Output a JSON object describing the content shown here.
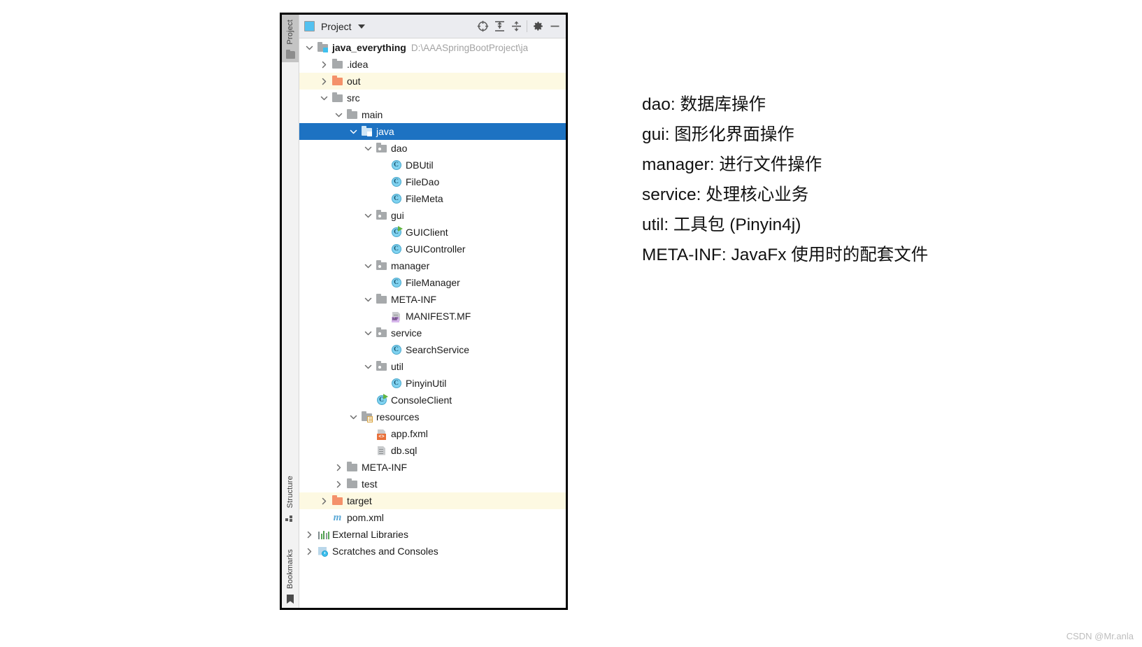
{
  "tool_strip": {
    "tabs_top": [
      {
        "label": "Project",
        "icon": "project-folder-icon"
      }
    ],
    "tabs_middle": [
      {
        "label": "Structure",
        "icon": "structure-icon"
      }
    ],
    "tabs_bottom": [
      {
        "label": "Bookmarks",
        "icon": "bookmark-icon"
      }
    ]
  },
  "panel": {
    "title": "Project",
    "view_icon": "project-view-icon",
    "dropdown_icon": "chevron-down-icon",
    "toolbar": [
      {
        "name": "select-opened-file-icon",
        "tooltip": "Select Opened File"
      },
      {
        "name": "expand-all-icon",
        "tooltip": "Expand All"
      },
      {
        "name": "collapse-all-icon",
        "tooltip": "Collapse All"
      },
      {
        "name": "settings-gear-icon",
        "tooltip": "Settings"
      },
      {
        "name": "hide-minimize-icon",
        "tooltip": "Hide"
      }
    ]
  },
  "tree": {
    "rows": [
      {
        "indent": 0,
        "arrow": "down",
        "icon": "source-root-folder",
        "label": "java_everything",
        "bold": true,
        "path": "D:\\AAASpringBootProject\\ja",
        "state": "normal"
      },
      {
        "indent": 1,
        "arrow": "right",
        "icon": "folder-gray",
        "label": ".idea",
        "state": "normal"
      },
      {
        "indent": 1,
        "arrow": "right",
        "icon": "folder-orange",
        "label": "out",
        "state": "excluded"
      },
      {
        "indent": 1,
        "arrow": "down",
        "icon": "folder-gray",
        "label": "src",
        "state": "normal"
      },
      {
        "indent": 2,
        "arrow": "down",
        "icon": "folder-gray",
        "label": "main",
        "state": "normal"
      },
      {
        "indent": 3,
        "arrow": "down",
        "icon": "source-root-folder",
        "label": "java",
        "state": "selected"
      },
      {
        "indent": 4,
        "arrow": "down",
        "icon": "package-folder",
        "label": "dao",
        "state": "normal"
      },
      {
        "indent": 5,
        "arrow": "none",
        "icon": "java-class",
        "label": "DBUtil",
        "state": "normal"
      },
      {
        "indent": 5,
        "arrow": "none",
        "icon": "java-class",
        "label": "FileDao",
        "state": "normal"
      },
      {
        "indent": 5,
        "arrow": "none",
        "icon": "java-class",
        "label": "FileMeta",
        "state": "normal"
      },
      {
        "indent": 4,
        "arrow": "down",
        "icon": "package-folder",
        "label": "gui",
        "state": "normal"
      },
      {
        "indent": 5,
        "arrow": "none",
        "icon": "java-class-runnable",
        "label": "GUIClient",
        "state": "normal"
      },
      {
        "indent": 5,
        "arrow": "none",
        "icon": "java-class",
        "label": "GUIController",
        "state": "normal"
      },
      {
        "indent": 4,
        "arrow": "down",
        "icon": "package-folder",
        "label": "manager",
        "state": "normal"
      },
      {
        "indent": 5,
        "arrow": "none",
        "icon": "java-class",
        "label": "FileManager",
        "state": "normal"
      },
      {
        "indent": 4,
        "arrow": "down",
        "icon": "folder-gray",
        "label": "META-INF",
        "state": "normal"
      },
      {
        "indent": 5,
        "arrow": "none",
        "icon": "manifest-file",
        "label": "MANIFEST.MF",
        "state": "normal"
      },
      {
        "indent": 4,
        "arrow": "down",
        "icon": "package-folder",
        "label": "service",
        "state": "normal"
      },
      {
        "indent": 5,
        "arrow": "none",
        "icon": "java-class",
        "label": "SearchService",
        "state": "normal"
      },
      {
        "indent": 4,
        "arrow": "down",
        "icon": "package-folder",
        "label": "util",
        "state": "normal"
      },
      {
        "indent": 5,
        "arrow": "none",
        "icon": "java-class",
        "label": "PinyinUtil",
        "state": "normal"
      },
      {
        "indent": 4,
        "arrow": "none",
        "icon": "java-class-runnable",
        "label": "ConsoleClient",
        "state": "normal"
      },
      {
        "indent": 3,
        "arrow": "down",
        "icon": "resource-root-folder",
        "label": "resources",
        "state": "normal"
      },
      {
        "indent": 4,
        "arrow": "none",
        "icon": "fxml-file",
        "label": "app.fxml",
        "state": "normal"
      },
      {
        "indent": 4,
        "arrow": "none",
        "icon": "sql-file",
        "label": "db.sql",
        "state": "normal"
      },
      {
        "indent": 2,
        "arrow": "right",
        "icon": "folder-gray",
        "label": "META-INF",
        "state": "normal"
      },
      {
        "indent": 2,
        "arrow": "right",
        "icon": "folder-gray",
        "label": "test",
        "state": "normal"
      },
      {
        "indent": 1,
        "arrow": "right",
        "icon": "folder-orange",
        "label": "target",
        "state": "excluded"
      },
      {
        "indent": 1,
        "arrow": "none",
        "icon": "maven-file",
        "label": "pom.xml",
        "state": "normal"
      },
      {
        "indent": 0,
        "arrow": "right",
        "icon": "external-libraries",
        "label": "External Libraries",
        "state": "normal"
      },
      {
        "indent": 0,
        "arrow": "right",
        "icon": "scratches-icon",
        "label": "Scratches and Consoles",
        "state": "normal"
      }
    ]
  },
  "notes": {
    "lines": [
      "dao: 数据库操作",
      "gui: 图形化界面操作",
      "manager: 进行文件操作",
      "service: 处理核心业务",
      "util: 工具包 (Pinyin4j)",
      "META-INF: JavaFx 使用时的配套文件"
    ]
  },
  "watermark": {
    "text": "CSDN @Mr.anla"
  },
  "colors": {
    "selection_blue": "#1d72c2",
    "excluded_yellow": "#fdf9e2",
    "folder_gray": "#a6a9ab",
    "folder_orange": "#f4916a",
    "class_blue": "#7fd2f0",
    "run_green": "#62b543",
    "header_bg": "#ebecf0"
  }
}
